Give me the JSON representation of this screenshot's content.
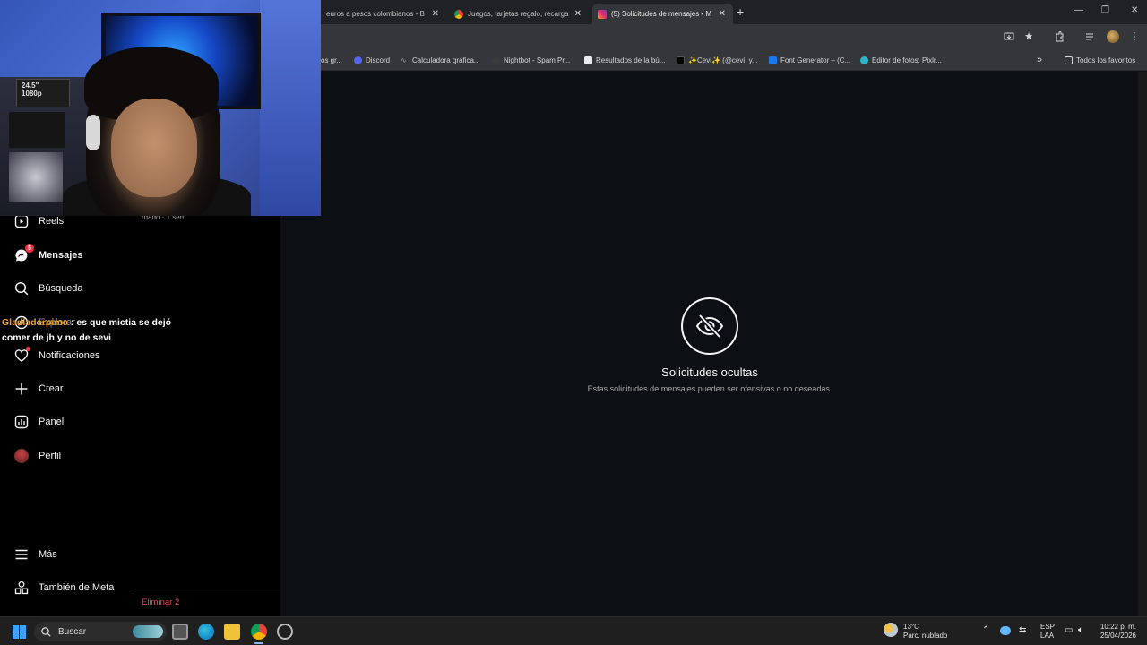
{
  "browser": {
    "tabs": [
      {
        "title": "euros a pesos colombianos - B",
        "active": false
      },
      {
        "title": "Juegos, tarjetas regalo, recarga",
        "active": false
      },
      {
        "title": "(5) Solicitudes de mensajes • M",
        "active": true
      }
    ],
    "new_tab_symbol": "+",
    "close_symbol": "✕",
    "window_controls": {
      "minimize": "—",
      "restore": "❐",
      "close": "✕"
    },
    "bookmarks": [
      {
        "label": "os gr...",
        "icon_color": "#8ab4f8"
      },
      {
        "label": "Discord",
        "icon_color": "#5865f2"
      },
      {
        "label": "Calculadora gráfica...",
        "icon_color": "#9aa0a6"
      },
      {
        "label": "Nightbot - Spam Pr...",
        "icon_color": "#2b2b2b"
      },
      {
        "label": "Resultados de la bú...",
        "icon_color": "#e8eaed"
      },
      {
        "label": "✨Cevi✨ (@cevi_y...",
        "icon_color": "#000000"
      },
      {
        "label": "Font Generator – (C...",
        "icon_color": "#1877f2"
      },
      {
        "label": "Editor de fotos: Pixlr...",
        "icon_color": "#2fb3c8"
      }
    ],
    "bookmarks_more": "»",
    "all_favorites": "Todos los favoritos"
  },
  "webcam": {
    "box_label_line1": "24.5\"",
    "box_label_line2": "1080p"
  },
  "sidebar": {
    "items": [
      {
        "label": "Reels",
        "icon": "reels-icon",
        "bold": false
      },
      {
        "label": "Mensajes",
        "icon": "messenger-icon",
        "bold": true,
        "badge": "5"
      },
      {
        "label": "Búsqueda",
        "icon": "search-icon",
        "bold": false
      },
      {
        "label": "Explorar",
        "icon": "compass-icon",
        "bold": false
      },
      {
        "label": "Notificaciones",
        "icon": "heart-icon",
        "bold": false,
        "dot": true
      },
      {
        "label": "Crear",
        "icon": "plus-icon",
        "bold": false
      },
      {
        "label": "Panel",
        "icon": "dashboard-icon",
        "bold": false
      },
      {
        "label": "Perfil",
        "icon": "avatar",
        "bold": false
      }
    ],
    "more": {
      "label": "Más",
      "icon": "hamburger-icon"
    },
    "meta": {
      "label": "También de Meta",
      "icon": "meta-grid-icon"
    }
  },
  "requests_panel": {
    "timestamp": "rdado · 1 sem",
    "delete_label": "Eliminar 2"
  },
  "chat_overlay": {
    "user": "Gladiadorpimo",
    "message": " : es que mictia se dejó comer de jh y no de sevi"
  },
  "empty_state": {
    "icon": "eye-off-icon",
    "title": "Solicitudes ocultas",
    "subtitle": "Estas solicitudes de mensajes pueden ser ofensivas o no deseadas."
  },
  "taskbar": {
    "search_placeholder": "Buscar",
    "weather_temp": "13°C",
    "weather_desc": "Parc. nublado",
    "lang_line1": "ESP",
    "lang_line2": "LAA",
    "time": "10:22 p. m.",
    "date": "25/04/2026"
  },
  "colors": {
    "accent": "#0095f6",
    "badge": "#ff3040",
    "delete": "#ed4956",
    "chat_user": "#f0a030"
  }
}
